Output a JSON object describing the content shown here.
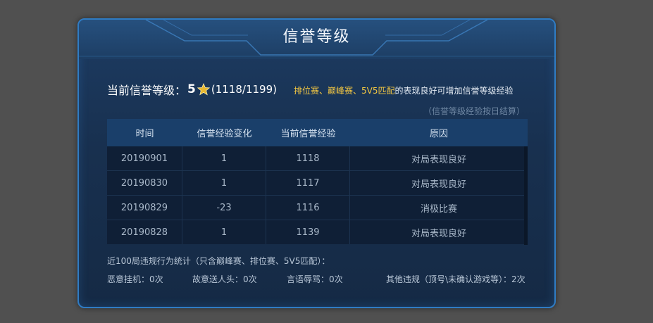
{
  "title": "信誉等级",
  "credit": {
    "label": "当前信誉等级：",
    "level": "5",
    "progress": "(1118/1199)",
    "tip_highlight": "排位赛、巅峰赛、5V5匹配",
    "tip_rest": "的表现良好可增加信誉等级经验",
    "settle_note": "（信誉等级经验按日结算）"
  },
  "table": {
    "headers": [
      "时间",
      "信誉经验变化",
      "当前信誉经验",
      "原因"
    ],
    "rows": [
      [
        "20190901",
        "1",
        "1118",
        "对局表现良好"
      ],
      [
        "20190830",
        "1",
        "1117",
        "对局表现良好"
      ],
      [
        "20190829",
        "-23",
        "1116",
        "消极比赛"
      ],
      [
        "20190828",
        "1",
        "1139",
        "对局表现良好"
      ]
    ]
  },
  "stats": {
    "title": "近100局违规行为统计（只含巅峰赛、排位赛、5V5匹配）：",
    "afk": "恶意挂机：0次",
    "feeding": "故意送人头：0次",
    "abuse": "言语辱骂：0次",
    "other": "其他违规（顶号\\未确认游戏等）：2次"
  },
  "colors": {
    "panel_border": "#2f7cc4",
    "highlight": "#f5c842",
    "star": "#e8b830"
  }
}
